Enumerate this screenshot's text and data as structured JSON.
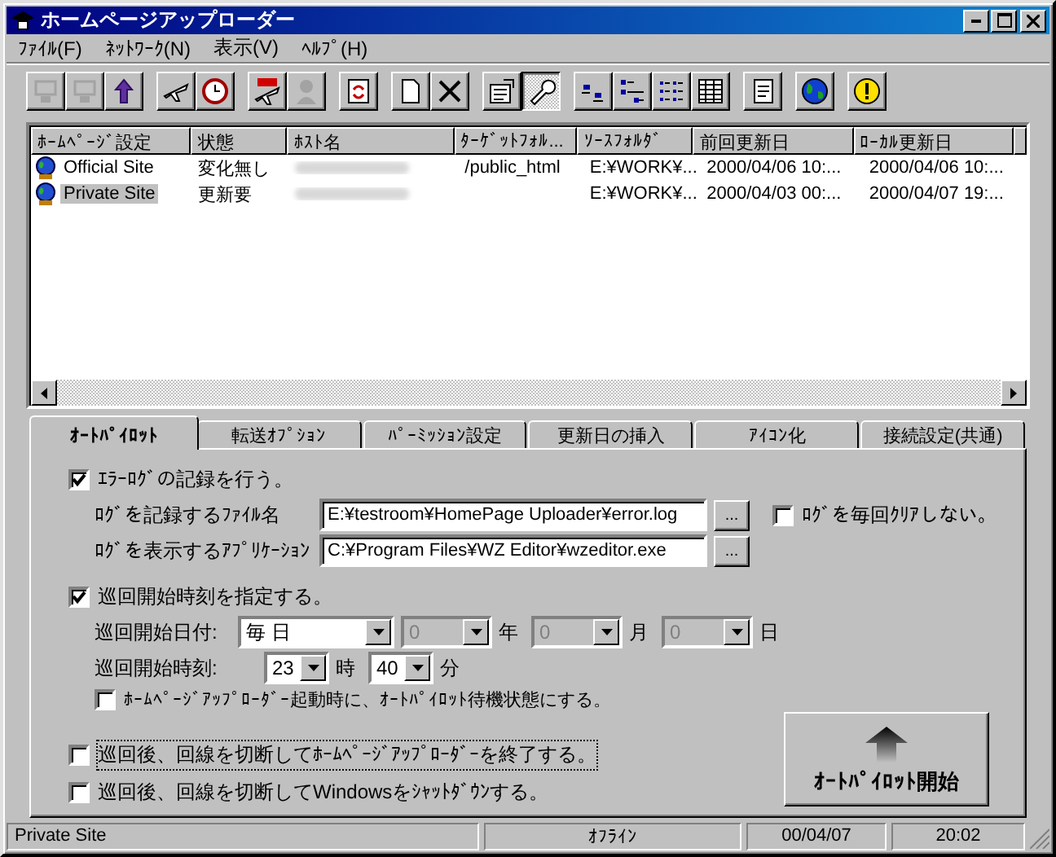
{
  "window": {
    "title": "ホームページアップローダー"
  },
  "menu": [
    "ﾌｧｲﾙ(F)",
    "ﾈｯﾄﾜｰｸ(N)",
    "表示(V)",
    "ﾍﾙﾌﾟ(H)"
  ],
  "toolbar": [
    [
      {
        "disabled": true,
        "pressed": false
      },
      {
        "disabled": true,
        "pressed": false
      },
      {
        "disabled": false,
        "pressed": false
      }
    ],
    [
      {
        "disabled": false,
        "pressed": false
      },
      {
        "disabled": false,
        "pressed": false
      }
    ],
    [
      {
        "disabled": false,
        "pressed": false
      },
      {
        "disabled": true,
        "pressed": false
      }
    ],
    [
      {
        "disabled": false,
        "pressed": false
      }
    ],
    [
      {
        "disabled": false,
        "pressed": false
      },
      {
        "disabled": false,
        "pressed": false
      }
    ],
    [
      {
        "disabled": false,
        "pressed": false
      },
      {
        "disabled": false,
        "pressed": true
      }
    ],
    [
      {
        "disabled": false,
        "pressed": false
      },
      {
        "disabled": false,
        "pressed": false
      },
      {
        "disabled": false,
        "pressed": false
      },
      {
        "disabled": false,
        "pressed": false
      }
    ],
    [
      {
        "disabled": false,
        "pressed": false
      }
    ],
    [
      {
        "disabled": false,
        "pressed": false
      }
    ],
    [
      {
        "disabled": false,
        "pressed": false
      }
    ]
  ],
  "table": {
    "columns": [
      "ﾎｰﾑﾍﾟｰｼﾞ設定",
      "状態",
      "ﾎｽﾄ名",
      "ﾀｰｹﾞｯﾄﾌｫﾙ...",
      "ｿｰｽﾌｫﾙﾀﾞ",
      "前回更新日",
      "ﾛｰｶﾙ更新日"
    ],
    "rows": [
      {
        "name": "Official Site",
        "status": "変化無し",
        "target": "/public_html",
        "source": "E:¥WORK¥...",
        "last_update": "2000/04/06 10:...",
        "local_update": "2000/04/06 10:...",
        "selected": false
      },
      {
        "name": "Private Site",
        "status": "更新要",
        "source": "E:¥WORK¥...",
        "last_update": "2000/04/03 00:...",
        "local_update": "2000/04/07 19:...",
        "selected": true
      }
    ]
  },
  "tabs": [
    {
      "label": "ｵｰﾄﾊﾟｲﾛｯﾄ",
      "selected": true
    },
    {
      "label": "転送ｵﾌﾟｼｮﾝ",
      "selected": false
    },
    {
      "label": "ﾊﾟｰﾐｯｼｮﾝ設定",
      "selected": false
    },
    {
      "label": "更新日の挿入",
      "selected": false
    },
    {
      "label": "ｱｲｺﾝ化",
      "selected": false
    },
    {
      "label": "接続設定(共通)",
      "selected": false
    }
  ],
  "autopilot": {
    "error_log": {
      "label": "ｴﾗｰﾛｸﾞの記録を行う。",
      "checked": true
    },
    "log_file": {
      "label": "ﾛｸﾞを記録するﾌｧｲﾙ名",
      "value": "E:¥testroom¥HomePage Uploader¥error.log",
      "button": "..."
    },
    "clear_log": {
      "label": "ﾛｸﾞを毎回ｸﾘｱしない。",
      "checked": false
    },
    "log_app": {
      "label": "ﾛｸﾞを表示するｱﾌﾟﾘｹｰｼｮﾝ",
      "value": "C:¥Program Files¥WZ Editor¥wzeditor.exe",
      "button": "..."
    },
    "schedule": {
      "label": "巡回開始時刻を指定する。",
      "checked": true
    },
    "date": {
      "label": "巡回開始日付:",
      "fields": [
        {
          "value": "毎 日",
          "disabled": false
        },
        {
          "value": "0",
          "unit": "年",
          "disabled": true
        },
        {
          "value": "0",
          "unit": "月",
          "disabled": true
        },
        {
          "value": "0",
          "unit": "日",
          "disabled": true
        }
      ]
    },
    "time": {
      "label": "巡回開始時刻:",
      "fields": [
        {
          "value": "23",
          "unit": "時",
          "disabled": false
        },
        {
          "value": "40",
          "unit": "分",
          "disabled": false
        }
      ]
    },
    "standby": {
      "label": "ﾎｰﾑﾍﾟｰｼﾞｱｯﾌﾟﾛｰﾀﾞｰ起動時に、ｵｰﾄﾊﾟｲﾛｯﾄ待機状態にする。",
      "checked": false
    },
    "after": [
      {
        "label": "巡回後、回線を切断してﾎｰﾑﾍﾟｰｼﾞｱｯﾌﾟﾛｰﾀﾞｰを終了する。",
        "checked": false,
        "focused": true
      },
      {
        "label": "巡回後、回線を切断してWindowsをｼｬｯﾄﾀﾞｳﾝする。",
        "checked": false,
        "focused": false
      }
    ],
    "start_button": {
      "label": "ｵｰﾄﾊﾟｲﾛｯﾄ開始"
    }
  },
  "status_bar": [
    "Private Site",
    "ｵﾌﾗｲﾝ",
    "00/04/07",
    "20:02"
  ]
}
